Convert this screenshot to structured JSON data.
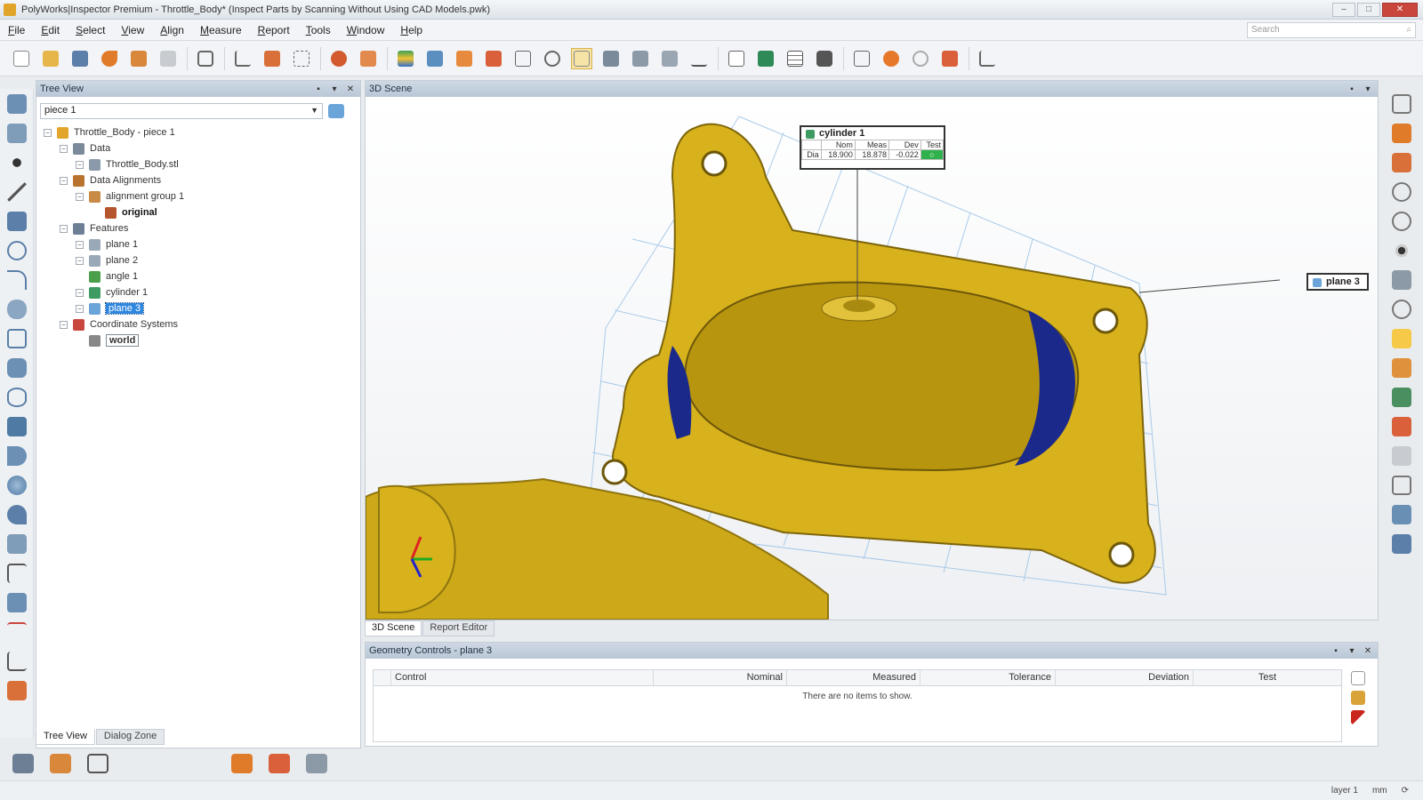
{
  "window": {
    "title": "PolyWorks|Inspector Premium - Throttle_Body* (Inspect Parts by Scanning Without Using CAD Models.pwk)"
  },
  "menu": [
    "File",
    "Edit",
    "Select",
    "View",
    "Align",
    "Measure",
    "Report",
    "Tools",
    "Window",
    "Help"
  ],
  "search": {
    "placeholder": "Search"
  },
  "tree_view": {
    "title": "Tree View",
    "piece_selector": "piece 1",
    "nodes": [
      {
        "label": "Throttle_Body - piece 1",
        "level": 0,
        "icon": "piece-icon",
        "color": "#e2a52b"
      },
      {
        "label": "Data",
        "level": 1,
        "icon": "data-icon",
        "color": "#7a8a9a"
      },
      {
        "label": "Throttle_Body.stl",
        "level": 2,
        "icon": "mesh-icon",
        "color": "#8a9aaa"
      },
      {
        "label": "Data Alignments",
        "level": 1,
        "icon": "alignment-icon",
        "color": "#b8732e"
      },
      {
        "label": "alignment group 1",
        "level": 2,
        "icon": "alignment-group-icon",
        "color": "#c98a45"
      },
      {
        "label": "original",
        "level": 3,
        "icon": "original-alignment-icon",
        "color": "#b5552e",
        "style": "bold"
      },
      {
        "label": "Features",
        "level": 1,
        "icon": "features-icon",
        "color": "#6c7f95"
      },
      {
        "label": "plane 1",
        "level": 2,
        "icon": "plane-icon",
        "color": "#9aa9b8"
      },
      {
        "label": "plane 2",
        "level": 2,
        "icon": "plane-icon",
        "color": "#9aa9b8"
      },
      {
        "label": "angle 1",
        "level": 2,
        "icon": "angle-icon",
        "color": "#4aa04a"
      },
      {
        "label": "cylinder 1",
        "level": 2,
        "icon": "cylinder-icon",
        "color": "#3e9b62"
      },
      {
        "label": "plane 3",
        "level": 2,
        "icon": "plane-icon",
        "color": "#6aa4d8",
        "style": "selected"
      },
      {
        "label": "Coordinate Systems",
        "level": 1,
        "icon": "coordinate-systems-icon",
        "color": "#c9463d"
      },
      {
        "label": "world",
        "level": 2,
        "icon": "world-axis-icon",
        "color": "#888",
        "style": "boxed"
      }
    ],
    "tabs": [
      "Tree View",
      "Dialog Zone"
    ]
  },
  "scene": {
    "title": "3D Scene",
    "tabs": [
      "3D Scene",
      "Report Editor"
    ],
    "cylinder_callout": {
      "name": "cylinder 1",
      "headers": [
        "Nom",
        "Meas",
        "Dev",
        "Test"
      ],
      "row": {
        "control": "Dia",
        "nom": "18.900",
        "meas": "18.878",
        "dev": "-0.022",
        "test": "pass"
      }
    },
    "plane_callout": "plane 3",
    "colors": {
      "part": "#d8b21c",
      "part_dark": "#a98a10",
      "void": "#1b2a8a",
      "grid": "#9cc3e6"
    }
  },
  "geometry_controls": {
    "title": "Geometry Controls - plane 3",
    "columns": [
      "Control",
      "Nominal",
      "Measured",
      "Tolerance",
      "Deviation",
      "Test"
    ],
    "empty_message": "There are no items to show."
  },
  "status": {
    "layer": "layer 1",
    "units": "mm"
  }
}
